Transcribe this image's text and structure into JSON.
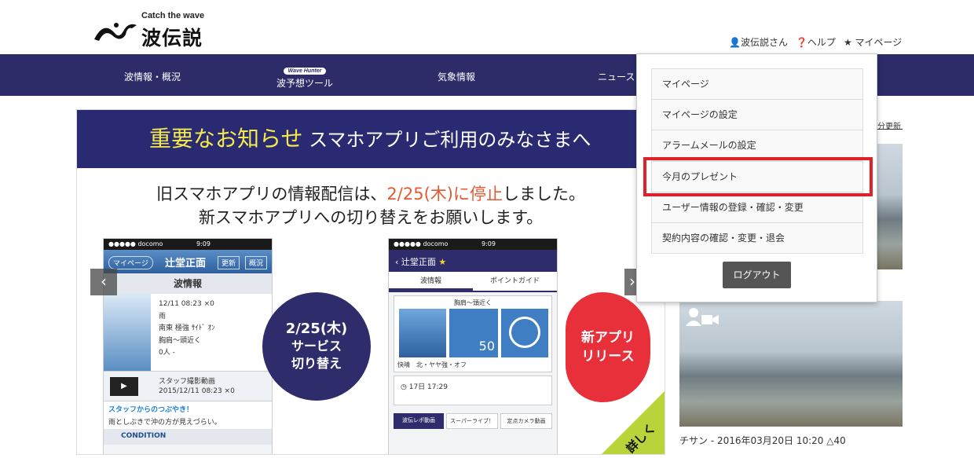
{
  "header": {
    "logo_tagline": "Catch the wave",
    "logo_text": "波伝説",
    "user_link": "波伝説さん",
    "help_link": "ヘルプ",
    "mypage_link": "マイページ"
  },
  "nav": {
    "items": [
      {
        "label": "波情報・概況"
      },
      {
        "label": "波予想ツール",
        "badge": "Wave Hunter"
      },
      {
        "label": "気象情報"
      },
      {
        "label": "ニュース"
      }
    ]
  },
  "banner": {
    "heading_highlight": "重要なお知らせ",
    "heading_rest": "スマホアプリご利用のみなさまへ",
    "line1_pre": "旧スマホアプリの情報配信は、",
    "line1_red": "2/25(木)に停止",
    "line1_post": "しました。",
    "line2": "新スマホアプリへの切り替えをお願いします。",
    "circle_left_line1": "2/25(木)",
    "circle_left_line2": "サービス",
    "circle_left_line3": "切り替え",
    "circle_right_line1": "新アプリ",
    "circle_right_line2": "リリース",
    "corner_label": "詳しく",
    "old_phone": {
      "carrier": "●●●●● docomo",
      "time": "9:09",
      "btn_mypage": "マイページ",
      "title": "辻堂正面",
      "btn_update": "更新",
      "btn_overview": "概況",
      "section": "波情報",
      "row1": "12/11 08:23 ×0",
      "row2": "雨",
      "row3": "南東 極強 ｻｲﾄﾞ ｵﾝ",
      "row4": "胸肩〜頭近く",
      "row5": "0人 -",
      "video_title": "スタッフ撮影動画",
      "video_time": "2015/12/11 08:23 ×0",
      "tweet_title": "スタッフからのつぶやき！",
      "tweet_text": "雨としぶきで沖の方が見えづらい。",
      "condition": "CONDITION"
    },
    "new_phone": {
      "carrier": "●●●●● docomo",
      "time": "9:09",
      "title": "辻堂正面",
      "tab1": "波情報",
      "tab2": "ポイントガイド",
      "size": "胸肩〜頭近く",
      "gauge": "50",
      "weather": "快晴　北・ヤヤ強・オフ",
      "time_row": "17日 17:29",
      "btn1": "波伝レポ動画",
      "btn2": "スーパーライブ！",
      "btn3": "定点カメラ動画"
    }
  },
  "side": {
    "update_link": "分更新",
    "caption": "チサン - 2016年03月20日 10:20 △40"
  },
  "dropdown": {
    "items": [
      {
        "label": "マイページ"
      },
      {
        "label": "マイページの設定"
      },
      {
        "label": "アラームメールの設定"
      },
      {
        "label": "今月のプレゼント"
      },
      {
        "label": "ユーザー情報の登録・確認・変更"
      },
      {
        "label": "契約内容の確認・変更・退会"
      }
    ],
    "logout": "ログアウト"
  }
}
